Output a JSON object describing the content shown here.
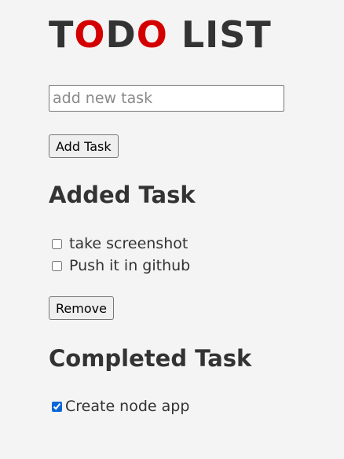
{
  "header": {
    "title_letters": [
      {
        "char": "T",
        "color": "#333333"
      },
      {
        "char": "O",
        "color": "#d40000"
      },
      {
        "char": "D",
        "color": "#333333"
      },
      {
        "char": "O",
        "color": "#d40000"
      },
      {
        "char": " ",
        "color": "#333333"
      },
      {
        "char": "L",
        "color": "#333333"
      },
      {
        "char": "I",
        "color": "#333333"
      },
      {
        "char": "S",
        "color": "#333333"
      },
      {
        "char": "T",
        "color": "#333333"
      }
    ]
  },
  "form": {
    "input_value": "",
    "input_placeholder": "add new task",
    "add_button_label": "Add Task"
  },
  "added": {
    "heading": "Added Task",
    "tasks": [
      {
        "text": "take screenshot",
        "checked": false
      },
      {
        "text": "Push it in github",
        "checked": false
      }
    ],
    "remove_button_label": "Remove"
  },
  "completed": {
    "heading": "Completed Task",
    "tasks": [
      {
        "text": "Create node app",
        "checked": true
      }
    ]
  },
  "colors": {
    "accent_red": "#d40000",
    "text_dark": "#333333",
    "background": "#f4f4f4",
    "checkbox_blue": "#0a66d8"
  }
}
